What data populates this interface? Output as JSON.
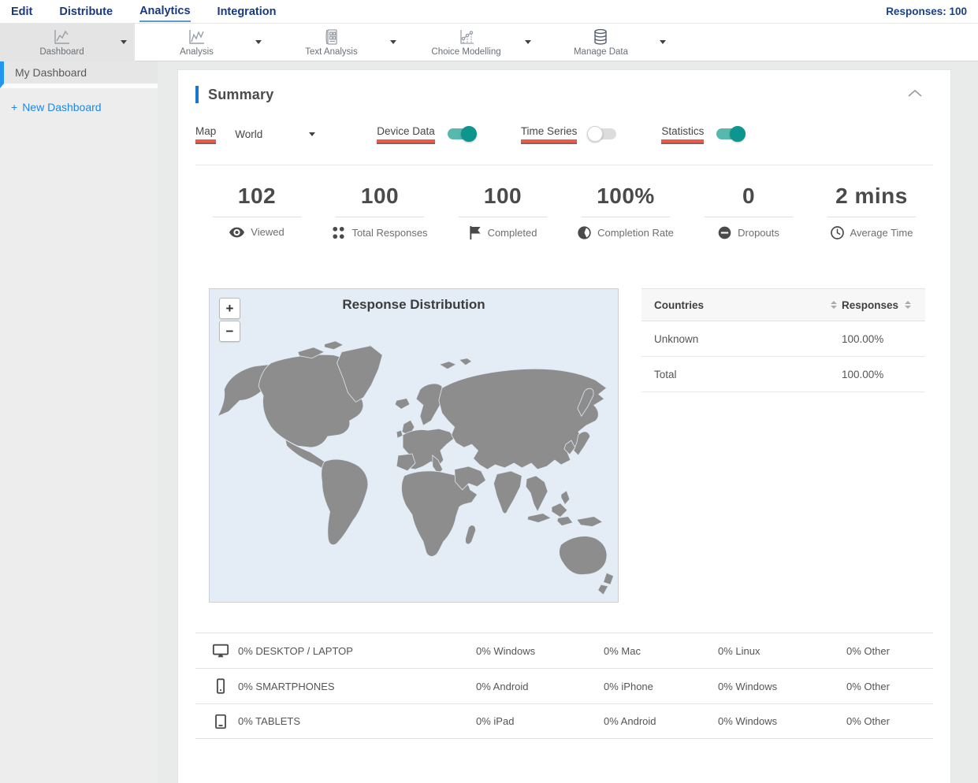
{
  "nav": {
    "items": [
      {
        "label": "Edit",
        "active": false
      },
      {
        "label": "Distribute",
        "active": false
      },
      {
        "label": "Analytics",
        "active": true
      },
      {
        "label": "Integration",
        "active": false
      }
    ],
    "responses_badge": "Responses: 100"
  },
  "toolbar": {
    "items": [
      {
        "label": "Dashboard",
        "icon": "line-chart-icon",
        "selected": true
      },
      {
        "label": "Analysis",
        "icon": "line-chart-icon",
        "selected": false
      },
      {
        "label": "Text Analysis",
        "icon": "document-grid-icon",
        "selected": false
      },
      {
        "label": "Choice Modelling",
        "icon": "scatter-chart-icon",
        "selected": false
      },
      {
        "label": "Manage Data",
        "icon": "database-icon",
        "selected": false
      }
    ]
  },
  "sidebar": {
    "items": [
      {
        "label": "My Dashboard",
        "active": true
      }
    ],
    "new_dashboard": {
      "plus": "+",
      "label": "New Dashboard"
    }
  },
  "summary": {
    "title": "Summary",
    "controls": {
      "map_label": "Map",
      "map_select_value": "World",
      "device_data_label": "Device Data",
      "device_data_on": true,
      "time_series_label": "Time Series",
      "time_series_on": false,
      "statistics_label": "Statistics",
      "statistics_on": true
    },
    "stats": [
      {
        "value": "102",
        "label": "Viewed",
        "icon": "eye-icon"
      },
      {
        "value": "100",
        "label": "Total Responses",
        "icon": "dots-grid-icon"
      },
      {
        "value": "100",
        "label": "Completed",
        "icon": "flag-icon"
      },
      {
        "value": "100%",
        "label": "Completion Rate",
        "icon": "half-circle-icon"
      },
      {
        "value": "0",
        "label": "Dropouts",
        "icon": "minus-circle-icon"
      },
      {
        "value": "2 mins",
        "label": "Average Time",
        "icon": "clock-icon"
      }
    ],
    "map": {
      "title": "Response Distribution",
      "zoom_in": "+",
      "zoom_out": "−"
    },
    "countries_table": {
      "columns": [
        "Countries",
        "Responses"
      ],
      "rows": [
        {
          "country": "Unknown",
          "responses": "100.00%"
        },
        {
          "country": "Total",
          "responses": "100.00%"
        }
      ]
    },
    "device_table": {
      "rows": [
        {
          "icon": "desktop-icon",
          "cells": [
            "0% DESKTOP / LAPTOP",
            "0% Windows",
            "0% Mac",
            "0% Linux",
            "0% Other"
          ]
        },
        {
          "icon": "smartphone-icon",
          "cells": [
            "0% SMARTPHONES",
            "0% Android",
            "0% iPhone",
            "0% Windows",
            "0% Other"
          ]
        },
        {
          "icon": "tablet-icon",
          "cells": [
            "0% TABLETS",
            "0% iPad",
            "0% Android",
            "0% Windows",
            "0% Other"
          ]
        }
      ]
    }
  },
  "colors": {
    "nav_blue": "#19397f",
    "accent_blue": "#1976d2",
    "link_blue": "#1e88e5",
    "highlight_red": "#ee5a4a",
    "toggle_on_track": "#57b8ae",
    "toggle_on_knob": "#0d968e",
    "map_background": "#e4edf6",
    "map_land": "#8d8d8d"
  }
}
